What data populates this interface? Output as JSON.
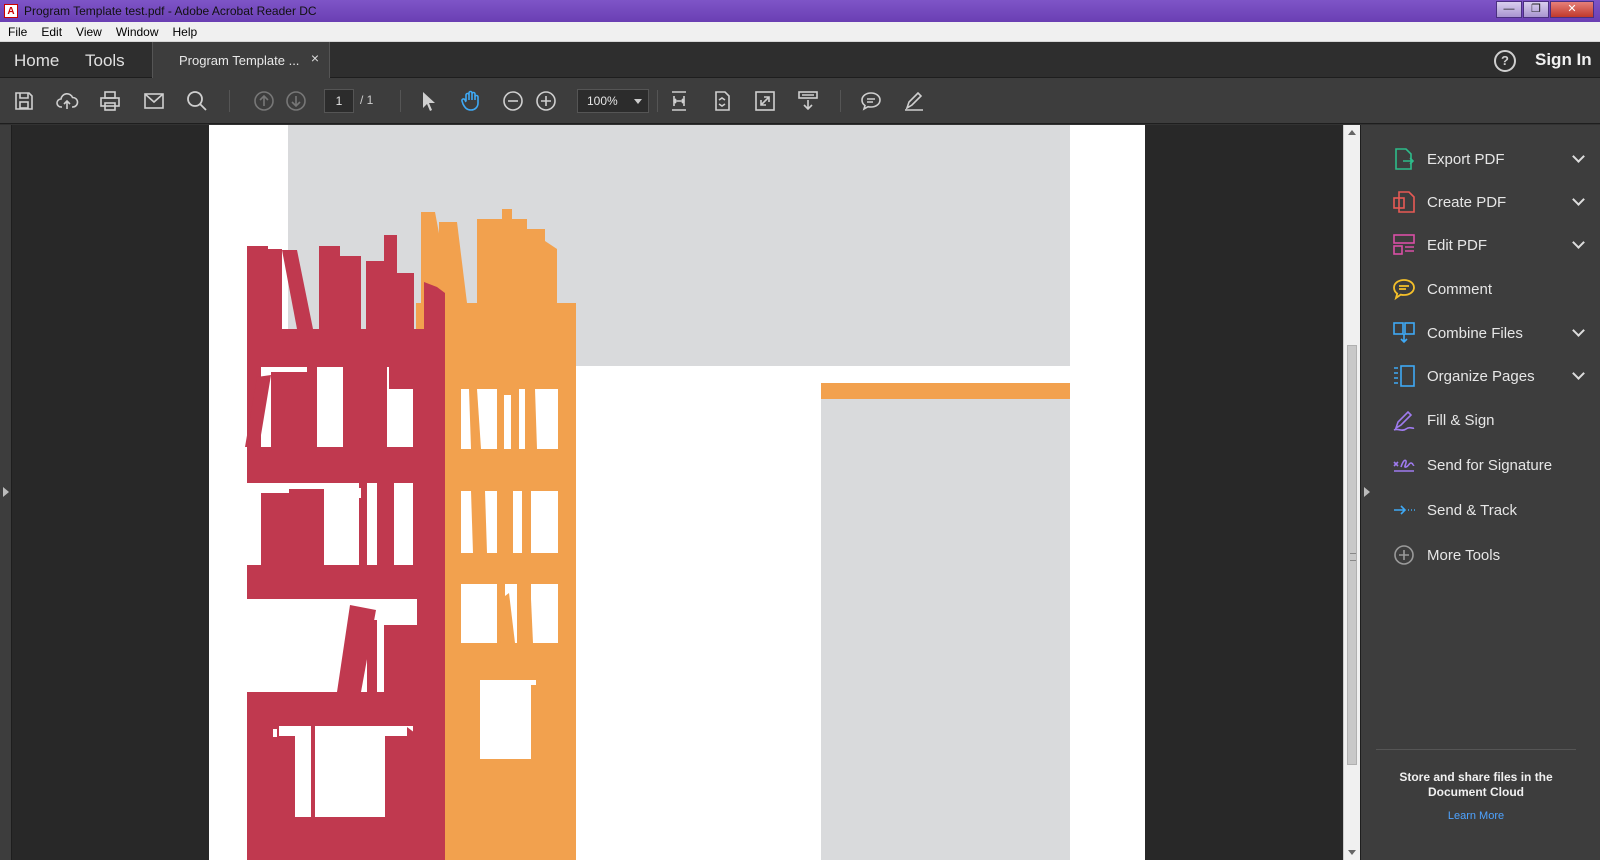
{
  "window": {
    "title": "Program Template test.pdf - Adobe Acrobat Reader DC"
  },
  "menu": [
    "File",
    "Edit",
    "View",
    "Window",
    "Help"
  ],
  "tabs": {
    "home": "Home",
    "tools": "Tools",
    "document": "Program Template ...",
    "close_glyph": "×"
  },
  "header": {
    "help": "?",
    "signin": "Sign In"
  },
  "toolbar": {
    "page_current": "1",
    "page_total": "/ 1",
    "zoom": "100%"
  },
  "colors": {
    "accent_red": "#c0394f",
    "accent_orange": "#f2a14e",
    "gray_block": "#d9dadc"
  },
  "tools": [
    {
      "label": "Export PDF",
      "icon": "export-pdf-icon",
      "color": "#2dbb8a",
      "expandable": true
    },
    {
      "label": "Create PDF",
      "icon": "create-pdf-icon",
      "color": "#e85a55",
      "expandable": true
    },
    {
      "label": "Edit PDF",
      "icon": "edit-pdf-icon",
      "color": "#d94fa6",
      "expandable": true
    },
    {
      "label": "Comment",
      "icon": "comment-icon",
      "color": "#f5c02a",
      "expandable": false
    },
    {
      "label": "Combine Files",
      "icon": "combine-files-icon",
      "color": "#3fa9f5",
      "expandable": true
    },
    {
      "label": "Organize Pages",
      "icon": "organize-pages-icon",
      "color": "#3fa9f5",
      "expandable": true
    },
    {
      "label": "Fill & Sign",
      "icon": "fill-sign-icon",
      "color": "#9f7bef",
      "expandable": false
    },
    {
      "label": "Send for Signature",
      "icon": "send-signature-icon",
      "color": "#9f7bef",
      "expandable": false
    },
    {
      "label": "Send & Track",
      "icon": "send-track-icon",
      "color": "#3fa9f5",
      "expandable": false
    },
    {
      "label": "More Tools",
      "icon": "more-tools-icon",
      "color": "#9a9a9a",
      "expandable": false
    }
  ],
  "cloud": {
    "text": "Store and share files in the Document Cloud",
    "link": "Learn More"
  }
}
